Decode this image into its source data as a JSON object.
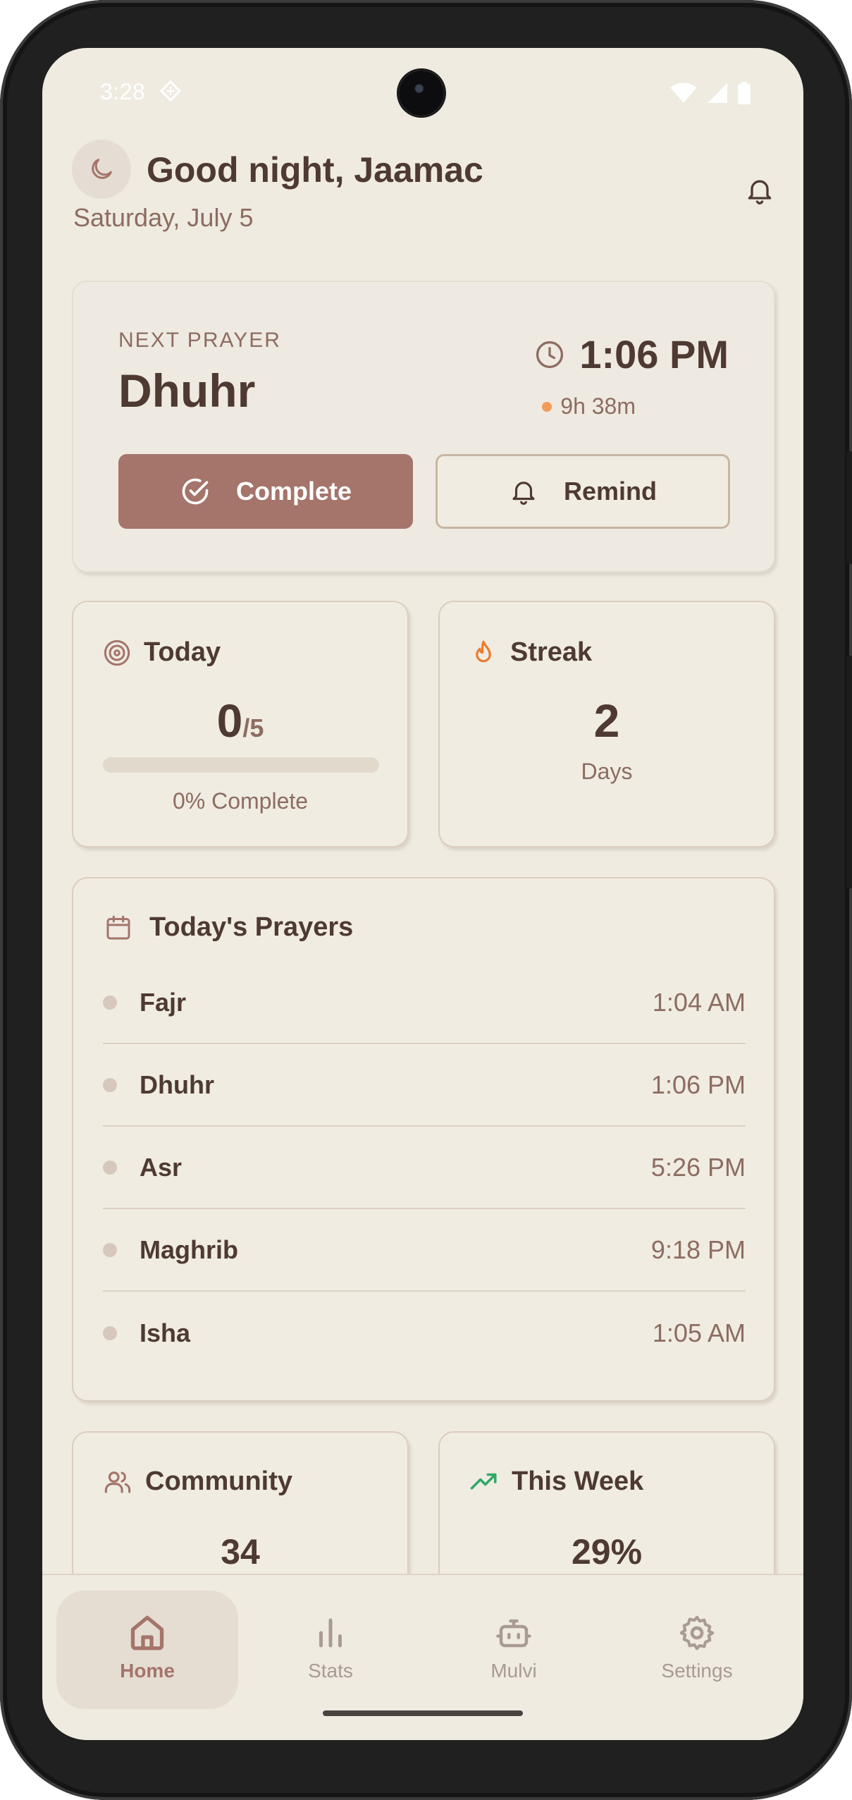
{
  "status_bar": {
    "time": "3:28"
  },
  "header": {
    "greeting": "Good night, Jaamac",
    "date": "Saturday, July 5"
  },
  "next_prayer": {
    "label": "NEXT PRAYER",
    "name": "Dhuhr",
    "time": "1:06 PM",
    "countdown": "9h 38m",
    "complete_label": "Complete",
    "remind_label": "Remind"
  },
  "today": {
    "title": "Today",
    "completed": "0",
    "total": "/5",
    "progress": 0,
    "percent_text": "0% Complete"
  },
  "streak": {
    "title": "Streak",
    "count": "2",
    "unit": "Days"
  },
  "prayers": {
    "title": "Today's Prayers",
    "items": [
      {
        "name": "Fajr",
        "time": "1:04 AM"
      },
      {
        "name": "Dhuhr",
        "time": "1:06 PM"
      },
      {
        "name": "Asr",
        "time": "5:26 PM"
      },
      {
        "name": "Maghrib",
        "time": "9:18 PM"
      },
      {
        "name": "Isha",
        "time": "1:05 AM"
      }
    ]
  },
  "community": {
    "title": "Community",
    "value": "34"
  },
  "this_week": {
    "title": "This Week",
    "value": "29%"
  },
  "nav": {
    "items": [
      {
        "label": "Home",
        "icon": "home-icon",
        "active": true
      },
      {
        "label": "Stats",
        "icon": "bar-chart-icon",
        "active": false
      },
      {
        "label": "Mulvi",
        "icon": "bot-icon",
        "active": false
      },
      {
        "label": "Settings",
        "icon": "gear-icon",
        "active": false
      }
    ]
  },
  "colors": {
    "background": "#efebe1",
    "accent": "#a5746a",
    "text_primary": "#4e3a33",
    "text_secondary": "#8d6c61",
    "streak_flame": "#ee7a2c",
    "trend_green": "#2fa866",
    "countdown_dot": "#f29b5a"
  }
}
